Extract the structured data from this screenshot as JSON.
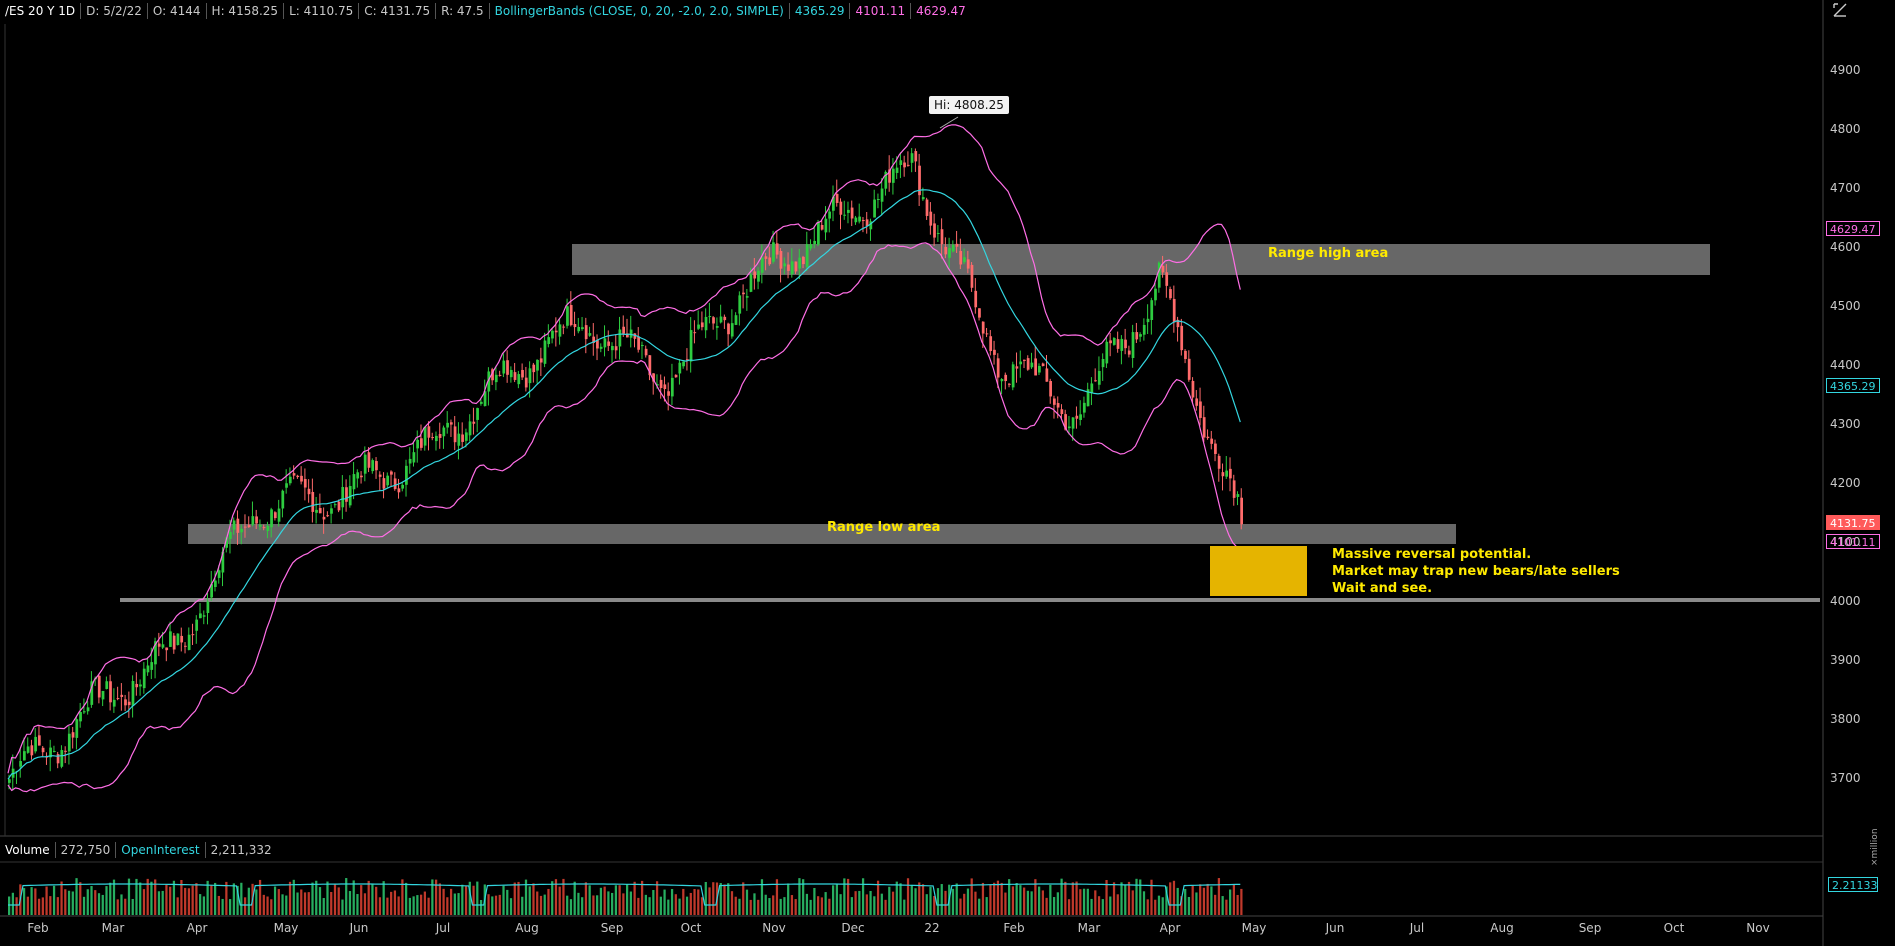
{
  "header": {
    "symbol": "/ES 20 Y 1D",
    "date": "D: 5/2/22",
    "open": "O: 4144",
    "high": "H: 4158.25",
    "low": "L: 4110.75",
    "close": "C: 4131.75",
    "range": "R: 47.5",
    "study": "BollingerBands (CLOSE, 0, 20, -2.0, 2.0, SIMPLE)",
    "mid_val": "4365.29",
    "lower_val": "4101.11",
    "upper_val": "4629.47"
  },
  "price_boxes": {
    "upper": "4629.47",
    "mid": "4365.29",
    "close": "4131.75",
    "lower": "4101.11"
  },
  "annotations": {
    "hi_tag": "Hi: 4808.25",
    "range_high": "Range high area",
    "range_low": "Range low area",
    "note_lines": [
      "Massive reversal potential.",
      "Market may trap new bears/late sellers",
      "Wait and see."
    ]
  },
  "volume_header": {
    "volume_label": "Volume",
    "volume_value": "272,750",
    "oi_label": "OpenInterest",
    "oi_value": "2,211,332",
    "oi_box": "2.21133",
    "unit": "×million"
  },
  "y_axis": [
    "4900",
    "4800",
    "4700",
    "4600",
    "4500",
    "4400",
    "4300",
    "4200",
    "4100",
    "4000",
    "3900",
    "3800",
    "3700"
  ],
  "x_axis": [
    "Feb",
    "Mar",
    "Apr",
    "May",
    "Jun",
    "Jul",
    "Aug",
    "Sep",
    "Oct",
    "Nov",
    "Dec",
    "22",
    "Feb",
    "Mar",
    "Apr",
    "May",
    "Jun",
    "Jul",
    "Aug",
    "Sep",
    "Oct",
    "Nov"
  ],
  "colors": {
    "up": "#2ecc40",
    "down": "#ff6b6b",
    "band": "#ff6ee6",
    "mid": "#33d6e0",
    "zone": "#8a8a8a",
    "note_box": "#e5b400",
    "label": "#ffea00"
  },
  "chart_data": {
    "type": "candlestick",
    "title": "",
    "series_anchor_closes": [
      {
        "x": "2021-01",
        "y": 3700
      },
      {
        "x": "2021-02",
        "y": 3820
      },
      {
        "x": "2021-03",
        "y": 3920
      },
      {
        "x": "2021-04",
        "y": 4160
      },
      {
        "x": "2021-05",
        "y": 4180
      },
      {
        "x": "2021-06",
        "y": 4250
      },
      {
        "x": "2021-07",
        "y": 4380
      },
      {
        "x": "2021-08",
        "y": 4480
      },
      {
        "x": "2021-09",
        "y": 4370
      },
      {
        "x": "2021-10",
        "y": 4540
      },
      {
        "x": "2021-11",
        "y": 4640
      },
      {
        "x": "2021-12",
        "y": 4740
      },
      {
        "x": "2022-01",
        "y": 4420
      },
      {
        "x": "2022-02",
        "y": 4320
      },
      {
        "x": "2022-03",
        "y": 4540
      },
      {
        "x": "2022-04",
        "y": 4131.75
      }
    ],
    "ylim": [
      3620,
      4950
    ],
    "key_levels": {
      "range_high": [
        4560,
        4610
      ],
      "range_low": [
        4100,
        4130
      ],
      "support_line": 4000,
      "high": 4808.25
    },
    "bollinger": {
      "upper": 4629.47,
      "mid": 4365.29,
      "lower": 4101.11
    },
    "open_interest": 2211332,
    "volume": 272750
  }
}
